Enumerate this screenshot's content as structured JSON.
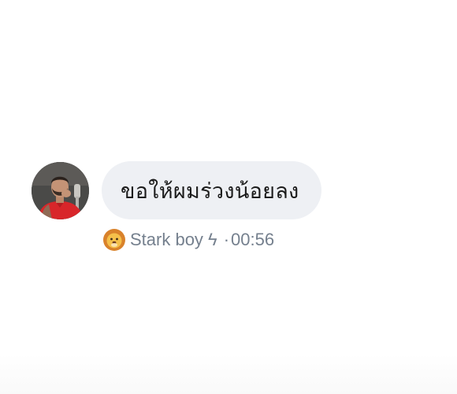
{
  "message": {
    "text": "ขอให้ผมร่วงน้อยลง",
    "sender_name": "Stark boy ϟ",
    "separator": "·",
    "time": "00:56",
    "sender_icon": "lion-emoji-icon",
    "avatar": "profile-photo-avatar"
  },
  "colors": {
    "bubble_bg": "#eef0f4",
    "text": "#1b1b1b",
    "meta_text": "#75808e",
    "background": "#ffffff"
  }
}
